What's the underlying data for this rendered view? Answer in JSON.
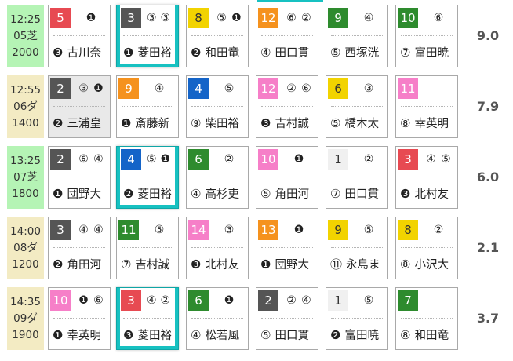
{
  "colors": {
    "turf_bg": "#b5f4b5",
    "dirt_bg": "#f3ebc3",
    "highlight": "#17c1c1",
    "waku": {
      "1": {
        "bg": "#f0f0f0",
        "fg": "#333333"
      },
      "2": {
        "bg": "#555555",
        "fg": "#ffffff"
      },
      "3": {
        "bg": "#e74a52",
        "fg": "#ffffff"
      },
      "4": {
        "bg": "#1464c8",
        "fg": "#ffffff"
      },
      "5": {
        "bg": "#f2d300",
        "fg": "#333333"
      },
      "6": {
        "bg": "#2e8b2e",
        "fg": "#ffffff"
      },
      "7": {
        "bg": "#f5921e",
        "fg": "#ffffff"
      },
      "8": {
        "bg": "#f67fc8",
        "fg": "#ffffff"
      }
    }
  },
  "races": [
    {
      "time": "12:25",
      "course": "05芝",
      "distance": "2000",
      "surface": "turf",
      "odds": "9.0",
      "horses": [
        {
          "num": "5",
          "waku": 3,
          "marks": [
            "❶"
          ],
          "rank_mark": "❸",
          "jockey": "古川奈",
          "highlight": false
        },
        {
          "num": "3",
          "waku": 2,
          "marks": [
            "③",
            "③"
          ],
          "rank_mark": "❶",
          "jockey": "菱田裕",
          "highlight": true
        },
        {
          "num": "8",
          "waku": 5,
          "marks": [
            "⑤",
            "❶"
          ],
          "rank_mark": "❷",
          "jockey": "和田竜",
          "highlight": false
        },
        {
          "num": "12",
          "waku": 7,
          "marks": [
            "⑥",
            "②"
          ],
          "rank_mark": "④",
          "jockey": "田口貫",
          "highlight": false
        },
        {
          "num": "9",
          "waku": 6,
          "marks": [
            "④"
          ],
          "rank_mark": "⑤",
          "jockey": "西塚洸",
          "highlight": false
        },
        {
          "num": "10",
          "waku": 6,
          "marks": [
            "⑥"
          ],
          "rank_mark": "⑦",
          "jockey": "富田暁",
          "highlight": false
        }
      ]
    },
    {
      "time": "12:55",
      "course": "06ダ",
      "distance": "1400",
      "surface": "dirt",
      "odds": "7.9",
      "horses": [
        {
          "num": "2",
          "waku": 2,
          "marks": [
            "③",
            "❶"
          ],
          "rank_mark": "❷",
          "jockey": "三浦皇",
          "highlight": false,
          "grey": true
        },
        {
          "num": "9",
          "waku": 7,
          "marks": [
            "④"
          ],
          "rank_mark": "❶",
          "jockey": "斎藤新",
          "highlight": false
        },
        {
          "num": "4",
          "waku": 4,
          "marks": [
            "⑤"
          ],
          "rank_mark": "⑨",
          "jockey": "柴田裕",
          "highlight": false
        },
        {
          "num": "12",
          "waku": 8,
          "marks": [
            "②",
            "⑥"
          ],
          "rank_mark": "❸",
          "jockey": "吉村誠",
          "highlight": false
        },
        {
          "num": "6",
          "waku": 5,
          "marks": [
            "③"
          ],
          "rank_mark": "⑤",
          "jockey": "橋木太",
          "highlight": false
        },
        {
          "num": "11",
          "waku": 8,
          "marks": [],
          "rank_mark": "⑧",
          "jockey": "幸英明",
          "highlight": false
        }
      ]
    },
    {
      "time": "13:25",
      "course": "07芝",
      "distance": "1800",
      "surface": "turf",
      "odds": "6.0",
      "horses": [
        {
          "num": "2",
          "waku": 2,
          "marks": [
            "⑥",
            "④"
          ],
          "rank_mark": "❶",
          "jockey": "団野大",
          "highlight": false
        },
        {
          "num": "4",
          "waku": 4,
          "marks": [
            "⑤",
            "❶"
          ],
          "rank_mark": "❷",
          "jockey": "菱田裕",
          "highlight": true
        },
        {
          "num": "6",
          "waku": 6,
          "marks": [
            "②"
          ],
          "rank_mark": "④",
          "jockey": "高杉吏",
          "highlight": false
        },
        {
          "num": "10",
          "waku": 8,
          "marks": [
            "❶"
          ],
          "rank_mark": "⑤",
          "jockey": "角田河",
          "highlight": false
        },
        {
          "num": "1",
          "waku": 1,
          "marks": [
            "②"
          ],
          "rank_mark": "⑦",
          "jockey": "田口貫",
          "highlight": false
        },
        {
          "num": "3",
          "waku": 3,
          "marks": [
            "④",
            "⑤"
          ],
          "rank_mark": "❸",
          "jockey": "北村友",
          "highlight": false
        }
      ]
    },
    {
      "time": "14:00",
      "course": "08ダ",
      "distance": "1200",
      "surface": "dirt",
      "odds": "2.1",
      "horses": [
        {
          "num": "3",
          "waku": 2,
          "marks": [
            "④",
            "④"
          ],
          "rank_mark": "❷",
          "jockey": "角田河",
          "highlight": false
        },
        {
          "num": "11",
          "waku": 6,
          "marks": [
            "⑤"
          ],
          "rank_mark": "⑦",
          "jockey": "吉村誠",
          "highlight": false
        },
        {
          "num": "14",
          "waku": 8,
          "marks": [
            "③"
          ],
          "rank_mark": "❸",
          "jockey": "北村友",
          "highlight": false
        },
        {
          "num": "13",
          "waku": 7,
          "marks": [
            "❶"
          ],
          "rank_mark": "❶",
          "jockey": "団野大",
          "highlight": false
        },
        {
          "num": "9",
          "waku": 5,
          "marks": [
            "⑤"
          ],
          "rank_mark": "⑪",
          "jockey": "永島ま",
          "highlight": false
        },
        {
          "num": "8",
          "waku": 5,
          "marks": [
            "②"
          ],
          "rank_mark": "⑧",
          "jockey": "小沢大",
          "highlight": false
        }
      ]
    },
    {
      "time": "14:35",
      "course": "09ダ",
      "distance": "1900",
      "surface": "dirt",
      "odds": "3.7",
      "horses": [
        {
          "num": "10",
          "waku": 8,
          "marks": [
            "❶",
            "⑥"
          ],
          "rank_mark": "❶",
          "jockey": "幸英明",
          "highlight": false
        },
        {
          "num": "3",
          "waku": 3,
          "marks": [
            "④",
            "②"
          ],
          "rank_mark": "❸",
          "jockey": "菱田裕",
          "highlight": true
        },
        {
          "num": "6",
          "waku": 6,
          "marks": [
            "❶"
          ],
          "rank_mark": "④",
          "jockey": "松若風",
          "highlight": false
        },
        {
          "num": "2",
          "waku": 2,
          "marks": [
            "②",
            "④"
          ],
          "rank_mark": "⑤",
          "jockey": "田口貫",
          "highlight": false
        },
        {
          "num": "1",
          "waku": 1,
          "marks": [
            "⑤"
          ],
          "rank_mark": "❷",
          "jockey": "富田暁",
          "highlight": false
        },
        {
          "num": "7",
          "waku": 6,
          "marks": [],
          "rank_mark": "⑧",
          "jockey": "和田竜",
          "highlight": false
        }
      ]
    }
  ]
}
